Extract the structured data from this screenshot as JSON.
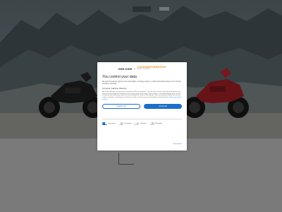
{
  "colors": {
    "accent": "#1c6ec8",
    "brand_orange": "#f28c1c",
    "switch_off": "#cfcfcf"
  },
  "consent": {
    "brand": {
      "onecom": "one.com",
      "plus": "+",
      "cookie_main": "COOKIEINFORMATION",
      "cookie_sub": "PRIVACY BY DEFAULT"
    },
    "title": "You control your data",
    "intro": "We and our business partners use technologies, including cookies, to collect information about you for various purposes, including:",
    "purposes": [
      "Functional",
      "Statistical",
      "Marketing"
    ],
    "details": "By clicking 'Accept', you give your consent for all these purposes. You can also choose to specify the purposes you consent to by ticking the checkbox next to the purpose and clicking 'Save settings'. You may withdraw your consent at any time by clicking the small icon at the bottom left corner of the website. You can read more about how we use cookies and other technologies and how we collect and process personal data by clicking the link.",
    "read_more": "Read more about cookies",
    "buttons": {
      "decline": "Decline all",
      "accept": "Accept all"
    },
    "toggles": [
      {
        "label": "Necessary",
        "on": true
      },
      {
        "label": "Functional",
        "on": false
      },
      {
        "label": "Statistics",
        "on": false
      },
      {
        "label": "Marketing",
        "on": false
      }
    ],
    "show_details": "Show details"
  }
}
